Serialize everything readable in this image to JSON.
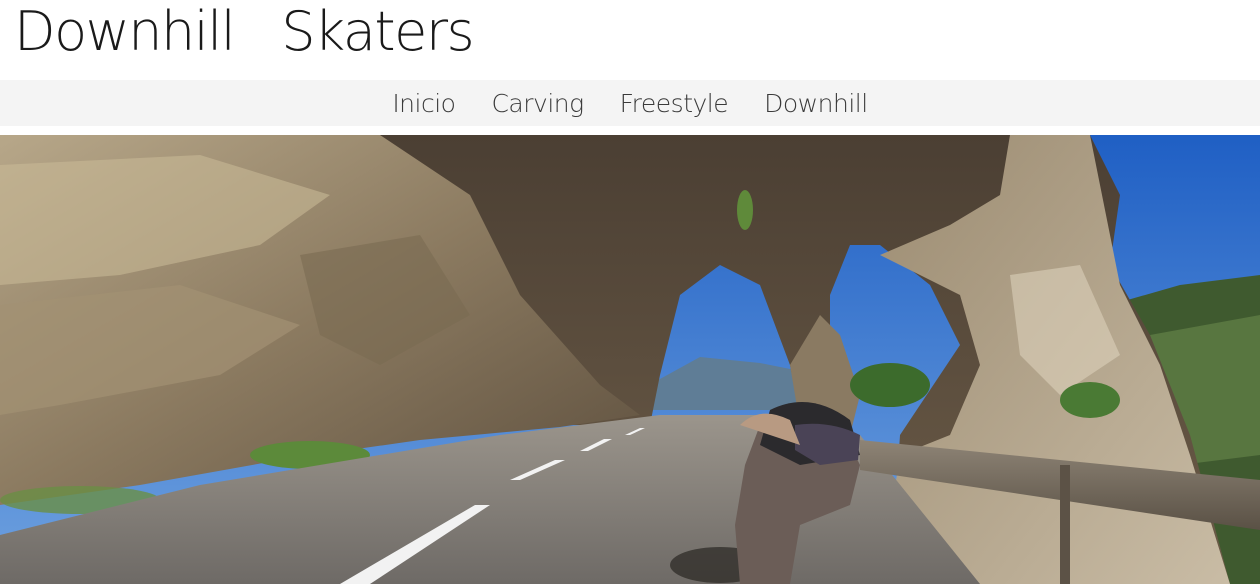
{
  "header": {
    "title": "Downhill   Skaters"
  },
  "nav": {
    "items": [
      {
        "label": "Inicio"
      },
      {
        "label": "Carving"
      },
      {
        "label": "Freestyle"
      },
      {
        "label": "Downhill"
      }
    ]
  },
  "colors": {
    "nav_background": "#f4f4f4",
    "title_text": "#1a1a1a",
    "nav_text": "#3a3a3a"
  }
}
